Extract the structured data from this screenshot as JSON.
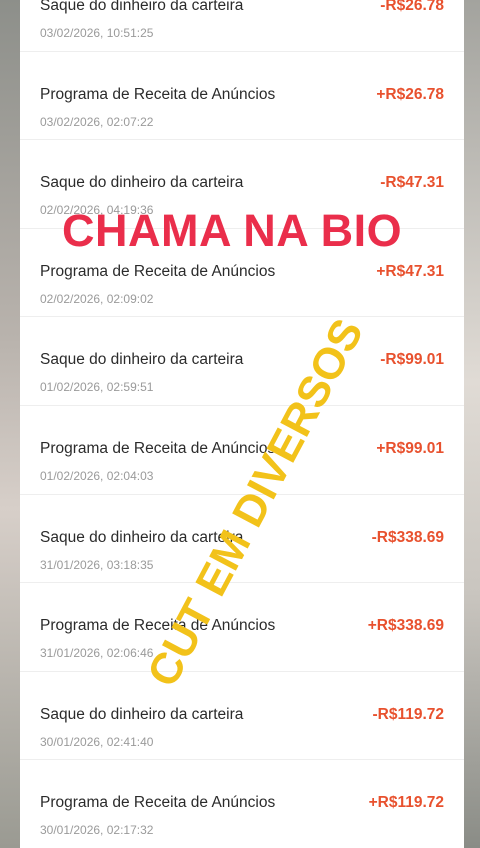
{
  "transactions": [
    {
      "title": "Saque do dinheiro da carteira",
      "date": "03/02/2026, 10:51:25",
      "amount": "-R$26.78"
    },
    {
      "title": "Programa de Receita de Anúncios",
      "date": "03/02/2026, 02:07:22",
      "amount": "+R$26.78"
    },
    {
      "title": "Saque do dinheiro da carteira",
      "date": "02/02/2026, 04:19:36",
      "amount": "-R$47.31"
    },
    {
      "title": "Programa de Receita de Anúncios",
      "date": "02/02/2026, 02:09:02",
      "amount": "+R$47.31"
    },
    {
      "title": "Saque do dinheiro da carteira",
      "date": "01/02/2026, 02:59:51",
      "amount": "-R$99.01"
    },
    {
      "title": "Programa de Receita de Anúncios",
      "date": "01/02/2026, 02:04:03",
      "amount": "+R$99.01"
    },
    {
      "title": "Saque do dinheiro da carteira",
      "date": "31/01/2026, 03:18:35",
      "amount": "-R$338.69"
    },
    {
      "title": "Programa de Receita de Anúncios",
      "date": "31/01/2026, 02:06:46",
      "amount": "+R$338.69"
    },
    {
      "title": "Saque do dinheiro da carteira",
      "date": "30/01/2026, 02:41:40",
      "amount": "-R$119.72"
    },
    {
      "title": "Programa de Receita de Anúncios",
      "date": "30/01/2026, 02:17:32",
      "amount": "+R$119.72"
    }
  ],
  "overlay": {
    "red_text": "CHAMA NA BIO",
    "yellow_text": "CUT EM DIVERSOS"
  },
  "colors": {
    "amount": "#e8512e",
    "overlay_red": "#ea2e4b",
    "overlay_yellow": "#f2c21a"
  }
}
